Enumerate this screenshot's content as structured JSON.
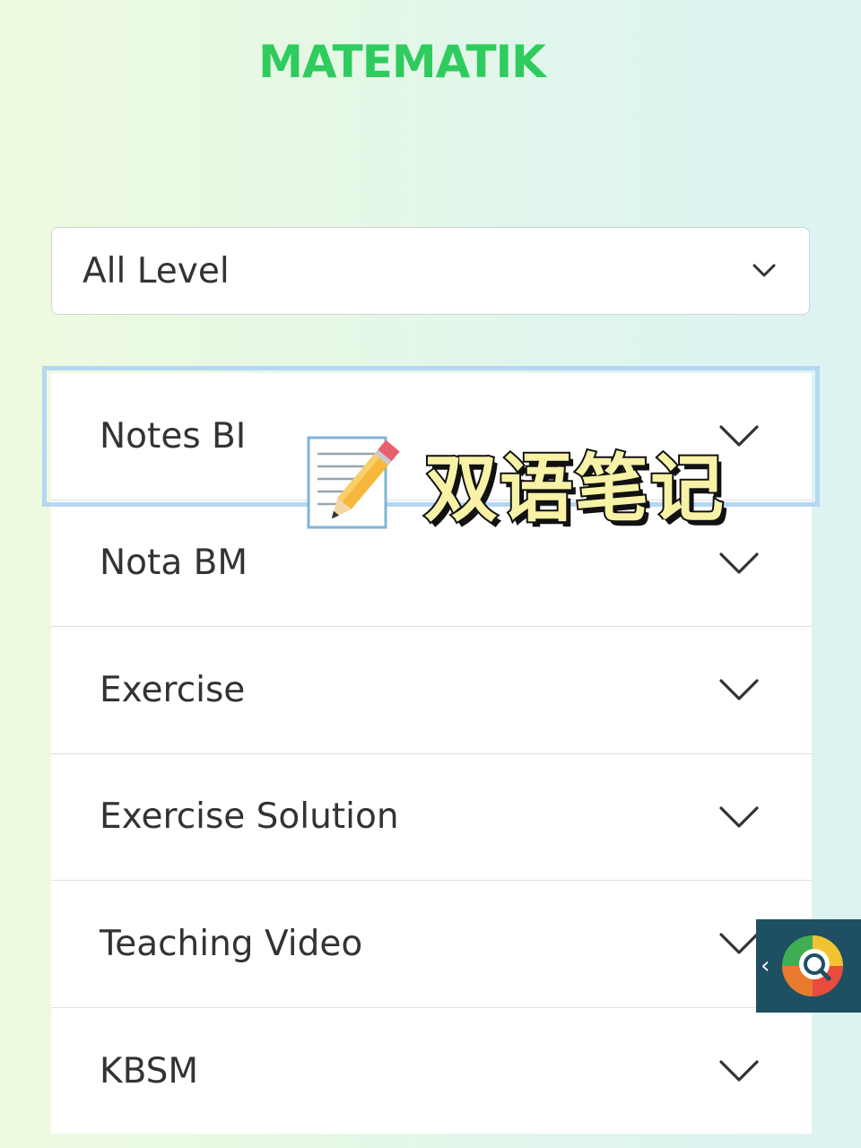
{
  "header": {
    "title": "MATEMATIK"
  },
  "level_select": {
    "value": "All Level",
    "icon": "chevron-down-icon"
  },
  "accordion": {
    "items": [
      {
        "label": "Notes BI",
        "icon": "chevron-down-icon"
      },
      {
        "label": "Nota BM",
        "icon": "chevron-down-icon"
      },
      {
        "label": "Exercise",
        "icon": "chevron-down-icon"
      },
      {
        "label": "Exercise Solution",
        "icon": "chevron-down-icon"
      },
      {
        "label": "Teaching Video",
        "icon": "chevron-down-icon"
      },
      {
        "label": "KBSM",
        "icon": "chevron-down-icon"
      }
    ]
  },
  "overlay": {
    "icon": "memo-pencil-icon",
    "text": "双语笔记"
  },
  "floating_widget": {
    "chevron_text": "‹",
    "icon": "search-app-icon"
  },
  "colors": {
    "title": "#2ecc5e",
    "focus_ring": "#b5d7f3",
    "widget_bg": "#1f4f63",
    "overlay_text": "#f7f2a6"
  }
}
